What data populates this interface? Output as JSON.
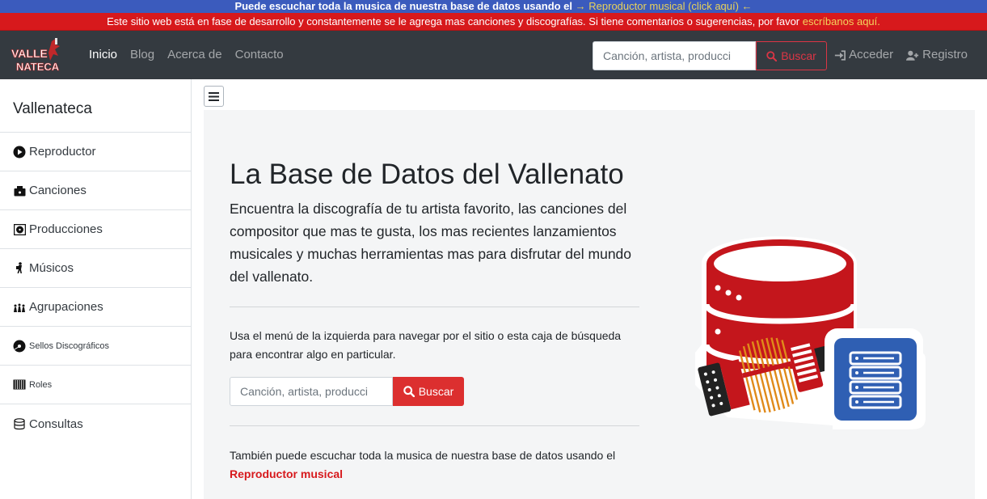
{
  "banner_top": {
    "text": "Puede escuchar toda la musica de nuestra base de datos usando el",
    "link": "→ Reproductor musical (click aquí) ←"
  },
  "banner_dev": {
    "text": "Este sitio web está en fase de desarrollo y constantemente se le agrega mas canciones y discografías. Si tiene comentarios o sugerencias, por favor",
    "link": "escríbanos aquí."
  },
  "navbar": {
    "logo_line1": "VALLE",
    "logo_line2": "NATECA",
    "links": [
      "Inicio",
      "Blog",
      "Acerca de",
      "Contacto"
    ],
    "search_placeholder": "Canción, artista, producci",
    "search_button": "Buscar",
    "login": "Acceder",
    "register": "Registro"
  },
  "sidebar": {
    "title": "Vallenateca",
    "items": [
      {
        "label": "Reproductor",
        "icon": "play-circle-icon"
      },
      {
        "label": "Canciones",
        "icon": "music-box-icon"
      },
      {
        "label": "Producciones",
        "icon": "vinyl-record-icon"
      },
      {
        "label": "Músicos",
        "icon": "musician-icon"
      },
      {
        "label": "Agrupaciones",
        "icon": "group-icon"
      },
      {
        "label": "Sellos Discográficos",
        "icon": "record-label-icon"
      },
      {
        "label": "Roles",
        "icon": "accordion-keys-icon"
      },
      {
        "label": "Consultas",
        "icon": "database-icon"
      }
    ]
  },
  "main": {
    "title": "La Base de Datos del Vallenato",
    "lead": "Encuentra la discografía de tu artista favorito, las canciones del compositor que mas te gusta, los mas recientes lanzamientos musicales y muchas herramientas mas para disfrutar del mundo del vallenato.",
    "instructions": "Usa el menú de la izquierda para navegar por el sitio o esta caja de búsqueda para encontrar algo en particular.",
    "search_placeholder": "Canción, artista, producci",
    "search_button": "Buscar",
    "player_text": "También puede escuchar toda la musica de nuestra base de datos usando el",
    "player_link": "Reproductor musical"
  },
  "colors": {
    "banner_blue": "#3b5bbd",
    "banner_red": "#d7191c",
    "navbar": "#343a40",
    "accent_red": "#dc2f2f",
    "server_blue": "#2f5fb3"
  }
}
